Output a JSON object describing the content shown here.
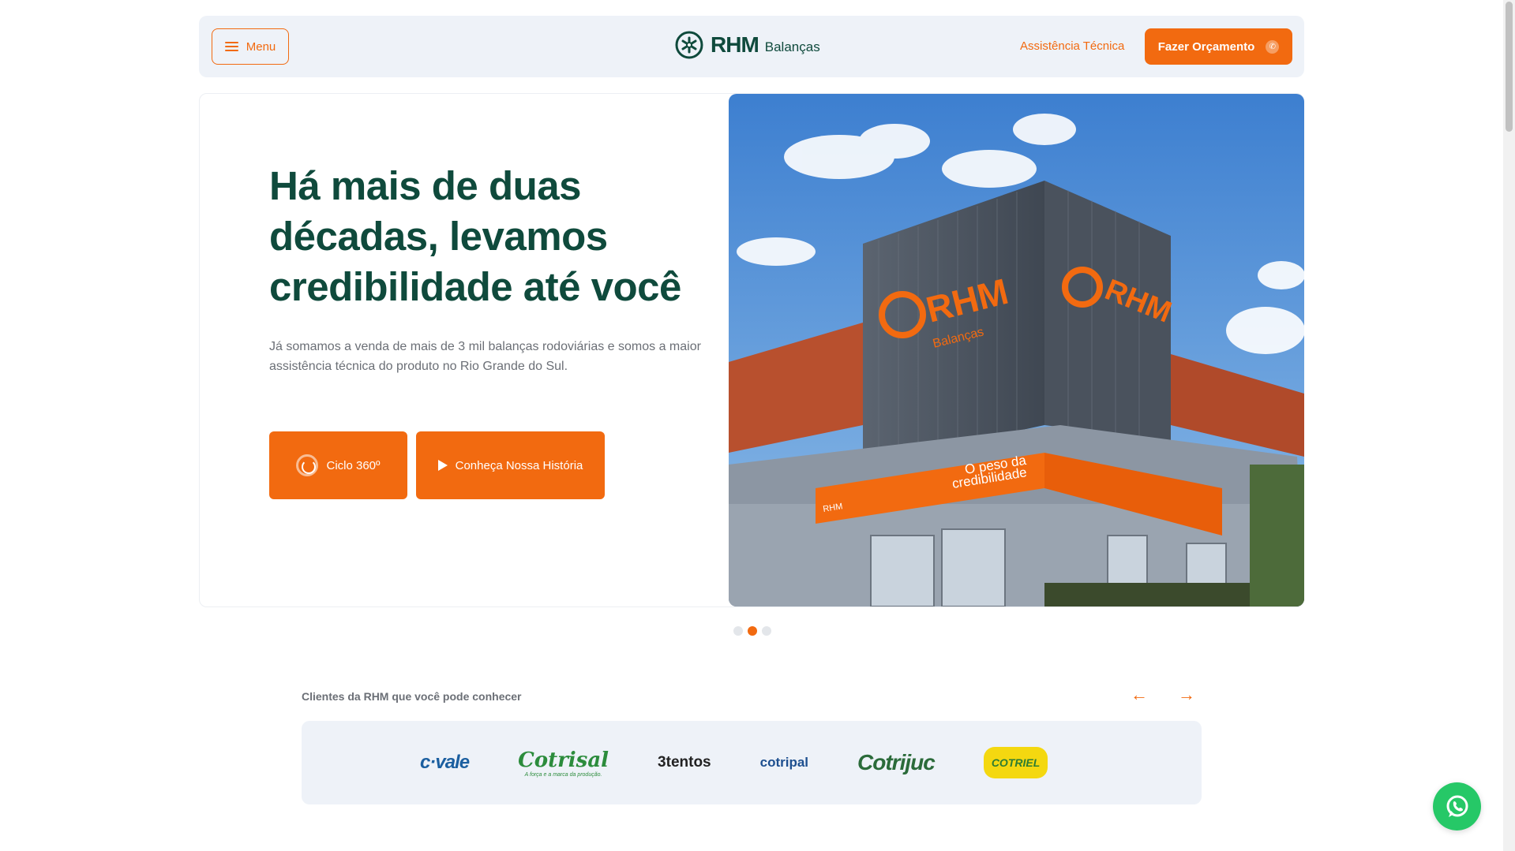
{
  "header": {
    "menu_label": "Menu",
    "logo_main": "RHM",
    "logo_sub": "Balanças",
    "assist_link": "Assistência Técnica",
    "quote_button": "Fazer Orçamento"
  },
  "hero": {
    "title": "Há mais de duas décadas, levamos credibilidade até você",
    "description": "Já somamos a venda de mais de 3 mil balanças rodoviárias e somos a maior assistência técnica do produto no Rio Grande do Sul.",
    "button_ciclo": "Ciclo 360º",
    "button_historia": "Conheça Nossa História",
    "image_signage": {
      "brand": "RHM",
      "brand_sub": "Balanças",
      "slogan_line1": "O peso da",
      "slogan_line2": "credibilidade"
    },
    "slides_total": 3,
    "slide_active": 2
  },
  "clients": {
    "label": "Clientes da RHM que você pode conhecer",
    "prev_arrow": "←",
    "next_arrow": "→",
    "logos": [
      "c·vale",
      "Cotrisal",
      "3tentos",
      "cotripal",
      "Cotrijuc",
      "COTRIEL"
    ],
    "cotrisal_tagline": "A força e a marca da produção."
  },
  "colors": {
    "brand_green": "#0f4a3c",
    "accent_orange": "#f26a10",
    "header_bg": "#eef2f8",
    "whatsapp_green": "#26c867"
  }
}
